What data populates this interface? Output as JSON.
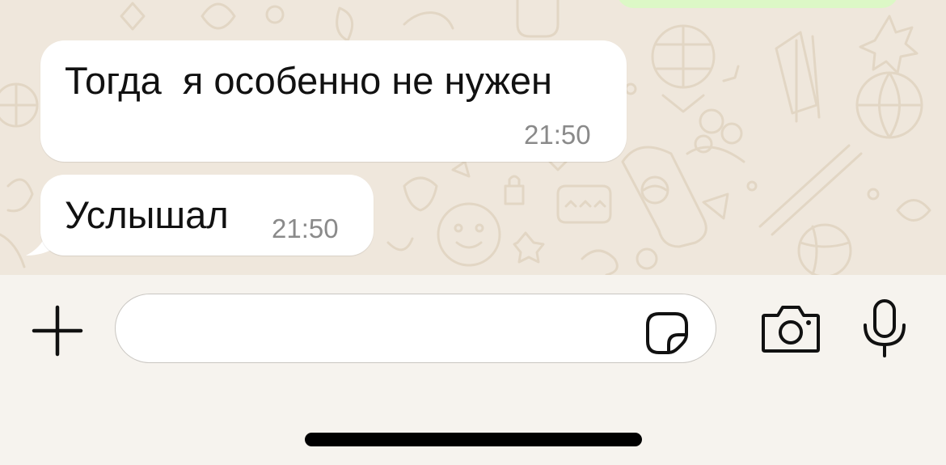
{
  "messages": [
    {
      "direction": "incoming",
      "text": "Тогда  я особенно не нужен",
      "time": "21:50"
    },
    {
      "direction": "incoming",
      "text": "Услышал",
      "time": "21:50"
    }
  ],
  "composer": {
    "placeholder": "",
    "icons": {
      "attach": "plus-icon",
      "sticker": "sticker-icon",
      "camera": "camera-icon",
      "voice": "microphone-icon"
    }
  },
  "colors": {
    "chat_background": "#efe7dc",
    "incoming_bubble": "#ffffff",
    "outgoing_bubble": "#dcf8c6",
    "composer_background": "#f6f3ee",
    "timestamp": "#8a8a8a"
  }
}
